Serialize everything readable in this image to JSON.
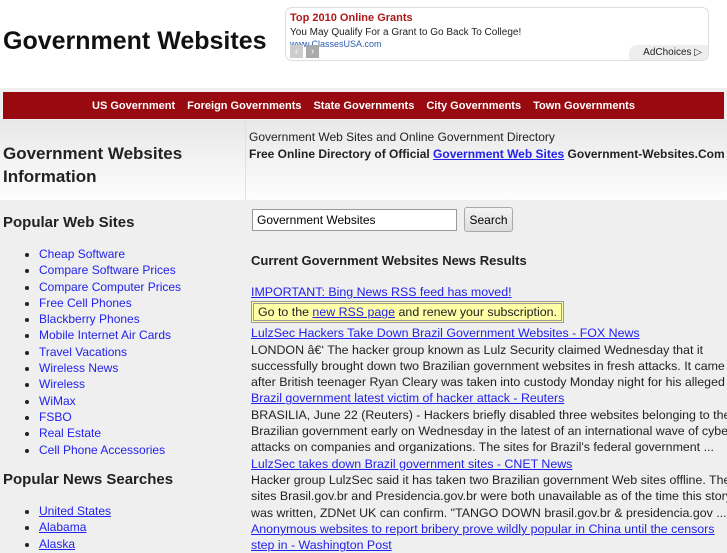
{
  "site_title": "Government Websites",
  "ad": {
    "title": "Top 2010 Online Grants",
    "desc": "You May Qualify For a Grant to Go Back To College!",
    "url": "www.ClassesUSA.com",
    "choices": "AdChoices"
  },
  "nav": [
    "US Government",
    "Foreign Governments",
    "State Governments",
    "City Governments",
    "Town Governments"
  ],
  "header": {
    "left_title": "Government Websites Information",
    "tagline": "Government Web Sites and Online Government Directory",
    "sub_prefix": "Free Online Directory of Official ",
    "sub_link": "Government Web Sites",
    "sub_suffix": " Government-Websites.Com"
  },
  "popular": {
    "title": "Popular Web Sites",
    "items": [
      "Cheap Software",
      "Compare Software Prices",
      "Compare Computer Prices",
      "Free Cell Phones",
      "Blackberry Phones",
      "Mobile Internet Air Cards",
      "Travel Vacations",
      "Wireless News",
      "Wireless",
      "WiMax",
      "FSBO",
      "Real Estate",
      "Cell Phone Accessories"
    ]
  },
  "news_searches": {
    "title": "Popular News Searches",
    "items": [
      "United States",
      "Alabama",
      "Alaska"
    ]
  },
  "search": {
    "value": "Government Websites",
    "button": "Search"
  },
  "results": {
    "title": "Current Government Websites News Results",
    "important": "IMPORTANT: Bing News RSS feed has moved!",
    "notice_pre": "Go to the ",
    "notice_link": "new RSS page",
    "notice_post": " and renew your subscription.",
    "items": [
      {
        "title": "LulzSec Hackers Take Down Brazil Government Websites - FOX News",
        "lines": [
          "LONDON â€‘ The hacker group known as Lulz Security claimed Wednesday that it",
          "successfully brought down two Brazilian government websites in fresh attacks. It came",
          "after British teenager Ryan Cleary was taken into custody Monday night for his alleged ..."
        ]
      },
      {
        "title": "Brazil government latest victim of hacker attack - Reuters",
        "lines": [
          "BRASILIA, June 22 (Reuters) - Hackers briefly disabled three websites belonging to the",
          "Brazilian government early on Wednesday in the latest of an international wave of cyber",
          "attacks on companies and organizations. The sites for Brazil's federal government ..."
        ]
      },
      {
        "title": "LulzSec takes down Brazil government sites - CNET News",
        "lines": [
          "Hacker group LulzSec said it has taken two Brazilian government Web sites offline. The",
          "sites Brasil.gov.br and Presidencia.gov.br were both unavailable as of the time this story",
          "was written, ZDNet UK can confirm. \"TANGO DOWN brasil.gov.br & presidencia.gov ..."
        ]
      },
      {
        "title": "Anonymous websites to report bribery prove wildly popular in China until the censors step in - Washington Post",
        "lines": []
      }
    ]
  }
}
